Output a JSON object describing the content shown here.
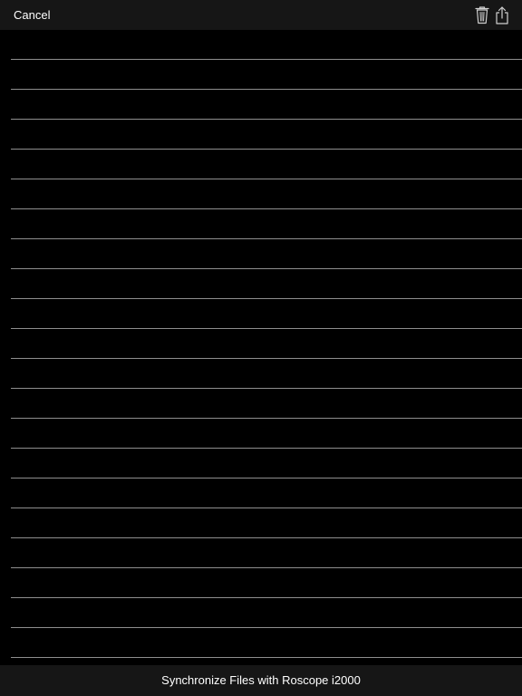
{
  "header": {
    "cancel_label": "Cancel",
    "trash_icon": "trash-icon",
    "share_icon": "share-icon"
  },
  "file_list": {
    "rows": [
      "",
      "",
      "",
      "",
      "",
      "",
      "",
      "",
      "",
      "",
      "",
      "",
      "",
      "",
      "",
      "",
      "",
      "",
      "",
      "",
      ""
    ]
  },
  "footer": {
    "sync_label": "Synchronize Files with Roscope i2000"
  },
  "colors": {
    "background": "#000000",
    "bar": "#161616",
    "separator": "#8e8e8e",
    "text": "#ffffff"
  }
}
